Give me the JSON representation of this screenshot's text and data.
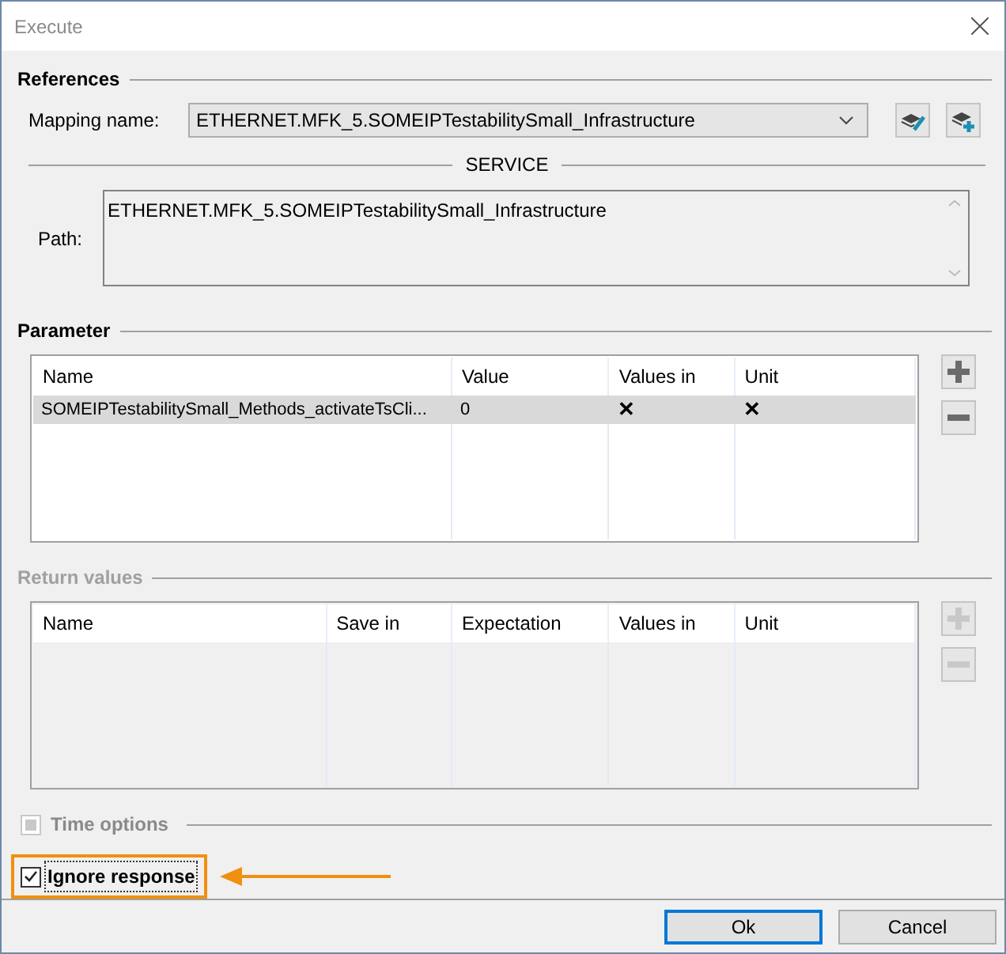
{
  "window": {
    "title": "Execute"
  },
  "references": {
    "title": "References",
    "mapping_label": "Mapping name:",
    "mapping_value": "ETHERNET.MFK_5.SOMEIPTestabilitySmall_Infrastructure",
    "service_heading": "SERVICE",
    "path_label": "Path:",
    "path_value": "ETHERNET.MFK_5.SOMEIPTestabilitySmall_Infrastructure"
  },
  "parameter": {
    "title": "Parameter",
    "disabled": false,
    "columns": [
      "Name",
      "Value",
      "Values in",
      "Unit"
    ],
    "rows": [
      {
        "selected": true,
        "cells": [
          "SOMEIPTestabilitySmall_Methods_activateTsCli...",
          "0",
          "✕",
          "✕"
        ]
      }
    ]
  },
  "return_values": {
    "title": "Return values",
    "disabled": true,
    "columns": [
      "Name",
      "Save in",
      "Expectation",
      "Values in",
      "Unit"
    ]
  },
  "time_options": {
    "label": "Time options",
    "checked": false,
    "disabled": true
  },
  "ignore_response": {
    "label": "Ignore response",
    "checked": true,
    "highlighted": true
  },
  "buttons": [
    {
      "label": "Ok",
      "default": true
    },
    {
      "label": "Cancel",
      "default": false
    }
  ]
}
